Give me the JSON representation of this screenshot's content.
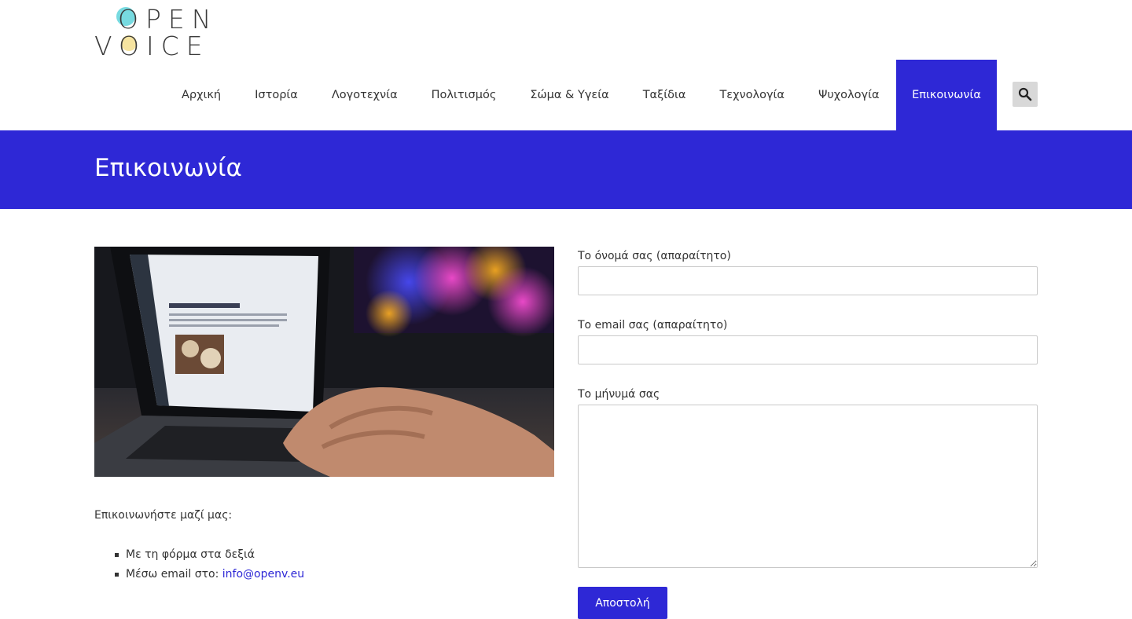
{
  "logo": {
    "line1": "OPEN",
    "line2": "VOICE"
  },
  "nav": {
    "items": [
      {
        "label": "Αρχική"
      },
      {
        "label": "Ιστορία"
      },
      {
        "label": "Λογοτεχνία"
      },
      {
        "label": "Πολιτισμός"
      },
      {
        "label": "Σώμα & Υγεία"
      },
      {
        "label": "Ταξίδια"
      },
      {
        "label": "Τεχνολογία"
      },
      {
        "label": "Ψυχολογία"
      },
      {
        "label": "Επικοινωνία"
      }
    ],
    "active": "Επικοινωνία",
    "search_icon": "search-icon"
  },
  "page": {
    "title": "Επικοινωνία"
  },
  "content": {
    "image_alt": "laptop-typing-photo",
    "intro": "Επικοινωνήστε μαζί μας:",
    "list": {
      "item1": "Με τη φόρμα στα δεξιά",
      "item2_prefix": "Μέσω email στο: ",
      "item2_link": "info@openv.eu"
    }
  },
  "form": {
    "name_label": "Το όνομά σας (απαραίτητο)",
    "name_value": "",
    "email_label": "Το email σας (απαραίτητο)",
    "email_value": "",
    "message_label": "Το μήνυμά σας",
    "message_value": "",
    "submit_label": "Αποστολή"
  },
  "colors": {
    "accent": "#2e28d6",
    "logo_teal": "#5fd3da",
    "logo_yellow": "#f4df8f"
  }
}
